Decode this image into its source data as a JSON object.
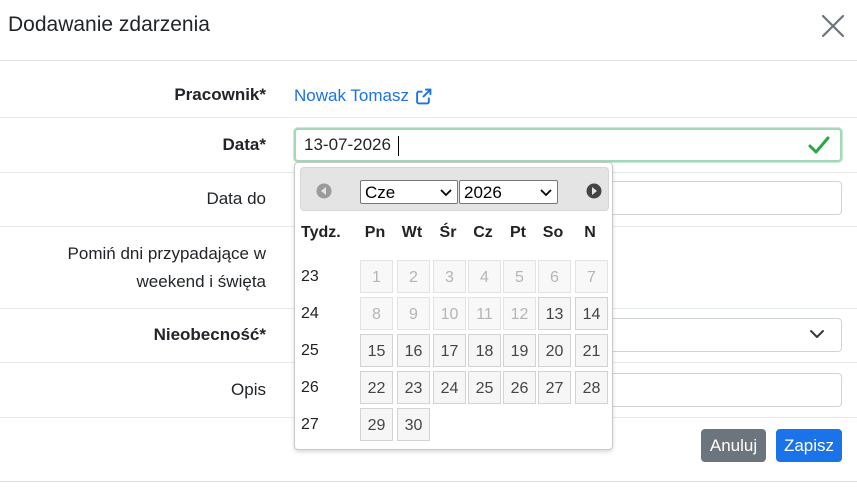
{
  "modal": {
    "title": "Dodawanie zdarzenia"
  },
  "form": {
    "employee_label": "Pracownik*",
    "employee_name": "Nowak Tomasz",
    "date_label": "Data*",
    "date_value": "13-07-2026",
    "date_to_label": "Data do",
    "date_to_value": "",
    "skip_label_line1": "Pomiń dni przypadające w",
    "skip_label_line2": "weekend i święta",
    "absence_label": "Nieobecność*",
    "absence_value": "",
    "description_label": "Opis",
    "description_value": ""
  },
  "buttons": {
    "cancel": "Anuluj",
    "save": "Zapisz"
  },
  "datepicker": {
    "month_selected": "Cze",
    "year_selected": "2026",
    "week_header": "Tydz.",
    "day_headers": [
      "Pn",
      "Wt",
      "Śr",
      "Cz",
      "Pt",
      "So",
      "N"
    ],
    "weeks": [
      {
        "week": "23",
        "days": [
          {
            "d": "1",
            "disabled": true
          },
          {
            "d": "2",
            "disabled": true
          },
          {
            "d": "3",
            "disabled": true
          },
          {
            "d": "4",
            "disabled": true
          },
          {
            "d": "5",
            "disabled": true
          },
          {
            "d": "6",
            "disabled": true
          },
          {
            "d": "7",
            "disabled": true
          }
        ]
      },
      {
        "week": "24",
        "days": [
          {
            "d": "8",
            "disabled": true
          },
          {
            "d": "9",
            "disabled": true
          },
          {
            "d": "10",
            "disabled": true
          },
          {
            "d": "11",
            "disabled": true
          },
          {
            "d": "12",
            "disabled": true
          },
          {
            "d": "13",
            "disabled": false
          },
          {
            "d": "14",
            "disabled": false
          }
        ]
      },
      {
        "week": "25",
        "days": [
          {
            "d": "15",
            "disabled": false
          },
          {
            "d": "16",
            "disabled": false
          },
          {
            "d": "17",
            "disabled": false
          },
          {
            "d": "18",
            "disabled": false
          },
          {
            "d": "19",
            "disabled": false
          },
          {
            "d": "20",
            "disabled": false
          },
          {
            "d": "21",
            "disabled": false
          }
        ]
      },
      {
        "week": "26",
        "days": [
          {
            "d": "22",
            "disabled": false
          },
          {
            "d": "23",
            "disabled": false
          },
          {
            "d": "24",
            "disabled": false
          },
          {
            "d": "25",
            "disabled": false
          },
          {
            "d": "26",
            "disabled": false
          },
          {
            "d": "27",
            "disabled": false
          },
          {
            "d": "28",
            "disabled": false
          }
        ]
      },
      {
        "week": "27",
        "days": [
          {
            "d": "29",
            "disabled": false
          },
          {
            "d": "30",
            "disabled": false
          }
        ]
      }
    ]
  },
  "icons": {
    "close": "close-icon",
    "external_link": "external-link-icon",
    "valid": "check-icon",
    "prev": "prev-month-icon",
    "next": "next-month-icon",
    "select_arrow": "chevron-down-icon"
  },
  "colors": {
    "link": "#1a73e8",
    "valid": "#28a745",
    "cancel_button": "#6c757d",
    "save_button": "#1a73e8"
  }
}
